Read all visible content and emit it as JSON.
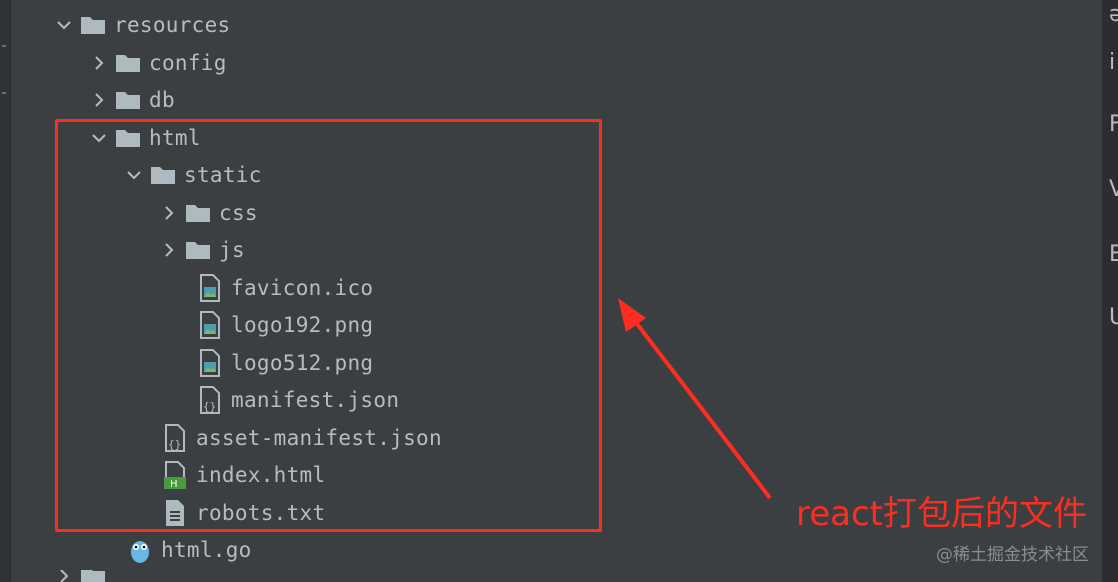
{
  "tree": {
    "items": [
      {
        "label": "resources",
        "type": "folder",
        "expanded": true
      },
      {
        "label": "config",
        "type": "folder",
        "expanded": false
      },
      {
        "label": "db",
        "type": "folder",
        "expanded": false
      },
      {
        "label": "html",
        "type": "folder",
        "expanded": true
      },
      {
        "label": "static",
        "type": "folder",
        "expanded": true
      },
      {
        "label": "css",
        "type": "folder",
        "expanded": false
      },
      {
        "label": "js",
        "type": "folder",
        "expanded": false
      },
      {
        "label": "favicon.ico",
        "type": "image-file"
      },
      {
        "label": "logo192.png",
        "type": "image-file"
      },
      {
        "label": "logo512.png",
        "type": "image-file"
      },
      {
        "label": "manifest.json",
        "type": "json-file"
      },
      {
        "label": "asset-manifest.json",
        "type": "json-file"
      },
      {
        "label": "index.html",
        "type": "html-file"
      },
      {
        "label": "robots.txt",
        "type": "text-file"
      },
      {
        "label": "html.go",
        "type": "go-file"
      }
    ]
  },
  "annotation": {
    "text": "react打包后的文件",
    "color": "#ff2d20"
  },
  "watermark": {
    "text": "@稀土掘金技术社区"
  },
  "right_gutter": {
    "chars": [
      "ə",
      "i",
      "F",
      "V",
      "E",
      "U"
    ]
  },
  "colors": {
    "background": "#3c3f41",
    "text": "#bbbbbb",
    "folder": "#aeb9c0",
    "highlight": "#ff2d20",
    "html_badge": "#4a9b3f"
  }
}
